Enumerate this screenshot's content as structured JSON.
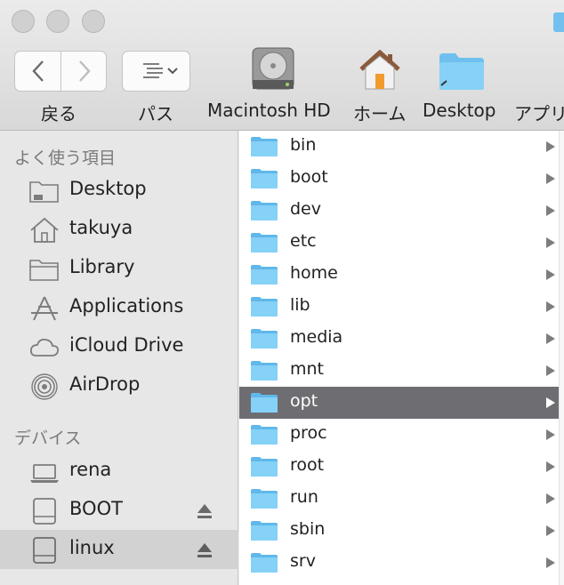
{
  "toolbar": {
    "back_label": "戻る",
    "path_label": "パス",
    "shortcuts": [
      {
        "label": "Macintosh HD",
        "icon": "hard-drive-icon"
      },
      {
        "label": "ホーム",
        "icon": "home-icon"
      },
      {
        "label": "Desktop",
        "icon": "folder-icon"
      },
      {
        "label": "アプリ",
        "icon": "applications-icon"
      }
    ]
  },
  "sidebar": {
    "favorites_header": "よく使う項目",
    "favorites": [
      {
        "label": "Desktop",
        "icon": "desktop-folder-icon"
      },
      {
        "label": "takuya",
        "icon": "home-icon"
      },
      {
        "label": "Library",
        "icon": "folder-icon"
      },
      {
        "label": "Applications",
        "icon": "applications-icon"
      },
      {
        "label": "iCloud Drive",
        "icon": "cloud-icon"
      },
      {
        "label": "AirDrop",
        "icon": "airdrop-icon"
      }
    ],
    "devices_header": "デバイス",
    "devices": [
      {
        "label": "rena",
        "icon": "laptop-icon"
      },
      {
        "label": "BOOT",
        "icon": "drive-icon",
        "eject": true
      },
      {
        "label": "linux",
        "icon": "drive-icon",
        "eject": true,
        "selected": true
      }
    ]
  },
  "files": [
    {
      "name": "bin"
    },
    {
      "name": "boot"
    },
    {
      "name": "dev"
    },
    {
      "name": "etc"
    },
    {
      "name": "home"
    },
    {
      "name": "lib"
    },
    {
      "name": "media"
    },
    {
      "name": "mnt"
    },
    {
      "name": "opt",
      "selected": true
    },
    {
      "name": "proc"
    },
    {
      "name": "root"
    },
    {
      "name": "run"
    },
    {
      "name": "sbin"
    },
    {
      "name": "srv"
    }
  ],
  "colors": {
    "folder_blue": "#7ccbf4",
    "selection_gray": "#6e6d72",
    "sidebar_bg": "#e7e7e7"
  }
}
